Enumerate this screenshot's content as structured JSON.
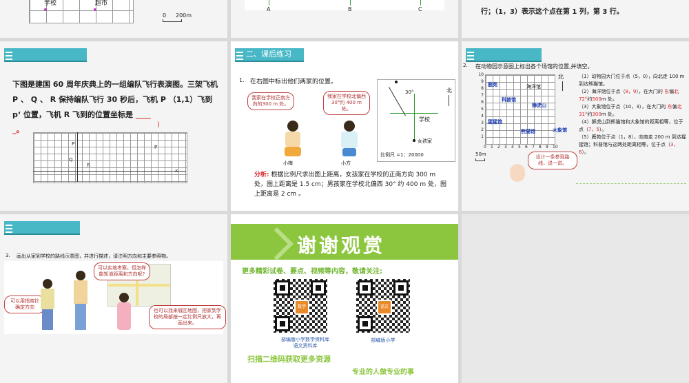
{
  "slide1": {
    "labels": [
      "学校",
      "超市"
    ],
    "scale": {
      "start": "0",
      "end": "200m"
    }
  },
  "slide2": {
    "labels": [
      "A",
      "B",
      "C"
    ]
  },
  "slide3": {
    "text": "行；（1，3）表示这个点在第 1 列，第 3 行。"
  },
  "slide4": {
    "body": "下图是建国 60 周年庆典上的一组编队飞行表演图。三架飞机 P 、 Q 、 R 保持编队飞行 30 秒后，飞机 P （1,1）飞到 p‘ 位置，飞机 R 飞到的位置坐标是",
    "blank_suffix": "_。",
    "answer_mark": ")"
  },
  "slide5": {
    "tab_title": "二、课后练习",
    "question_num": "1.",
    "question": "在右图中标出他们两家的位置。",
    "bubble_left": "我家在学校正南方向的300 m 处。",
    "bubble_right": "我家在学校北偏西 30°约 400 m 处。",
    "name_left": "小梅",
    "name_right": "小方",
    "map_north": "北",
    "map_angle": "30°",
    "map_school": "学校",
    "map_girl_home": "女孩家",
    "map_scale": "比例尺 =1：20000",
    "analysis_label": "分析:",
    "analysis": "根据比例尺求出图上距离，女孩家在学校的正南方向 300 m 处，图上距离是 1.5 cm；男孩家在学校北偏西 30° 约 400 m 处，图上距离是 2 cm 。"
  },
  "slide6": {
    "question_num": "2.",
    "question": "在动物园示意图上标出各个场馆的位置,并填空。",
    "north": "北",
    "venues": [
      "鹿苑",
      "海洋馆",
      "科普馆",
      "狮虎山",
      "猩猩馆",
      "熊猫馆",
      "大象馆"
    ],
    "x_ticks": [
      "0",
      "1",
      "2",
      "3",
      "4",
      "5",
      "6",
      "7",
      "8",
      "9",
      "10"
    ],
    "y_ticks": [
      "10",
      "9",
      "8",
      "7",
      "6",
      "5",
      "4",
      "3",
      "2",
      "1"
    ],
    "scale": "50m",
    "items": [
      "（1）动物园大门位于点（5，0），向北走 100 m 到达熊猫馆。",
      "（2）海洋馆位于点（",
      "（3）大象馆位于点（10，3），在大门的",
      "（4）狮虎山到熊猫馆和大象馆的距离相等，位于点（",
      "（5）鹿苑位于点（1，8），向南走 200 m 到达猩猩馆；科普馆与这两处距离相等，位于点（"
    ],
    "ans2_coord": "8，9",
    "ans2_dir1": "东",
    "ans2_dir2": "北",
    "ans2_angle": "72°",
    "ans2_dist": "500",
    "ans3_dir1": "东",
    "ans3_dir2": "北",
    "ans3_angle": "31°",
    "ans3_dist": "300",
    "ans4": "7，5",
    "ans5": "3，6",
    "item2_mid": "），在大门的",
    "item2_pian": "偏",
    "item2_yue": "约",
    "item2_end": "m 处。",
    "item3_pian": "偏",
    "item3_yue": "约",
    "item3_end": "m 处。",
    "close": "）。",
    "item3_text": "（3）大象馆位于点（10，3），在大门的",
    "hint": "设计一条参观路线，说一说。"
  },
  "slide7": {
    "question_num": "3.",
    "question": "画出从家到学校的路线示意图，并进行描述，请注明方向和主要参照物。",
    "bubble1": "可以实地考察。但怎样能知道距离和方向呢?",
    "bubble2": "可以用指南针确定方向",
    "bubble3": "也可以找来城区地图，把家到学校的局部按一定比例尺放大，再画出来。"
  },
  "slide8": {
    "title": "谢谢观赏",
    "subtitle": "更多精彩试卷、要点、视频等内容，敬请关注:",
    "qr1_caption": "部编版小学数学资料库\n语文资料库",
    "qr2_caption": "部编版小学",
    "qr1_logo": "数学",
    "qr2_logo": "语文",
    "bottom1": "扫描二维码获取更多资源",
    "bottom2": "专业的人做专业的事"
  },
  "colors": {
    "tab": "#49b8c6",
    "green": "#8cc63f",
    "red": "#d9262b"
  }
}
